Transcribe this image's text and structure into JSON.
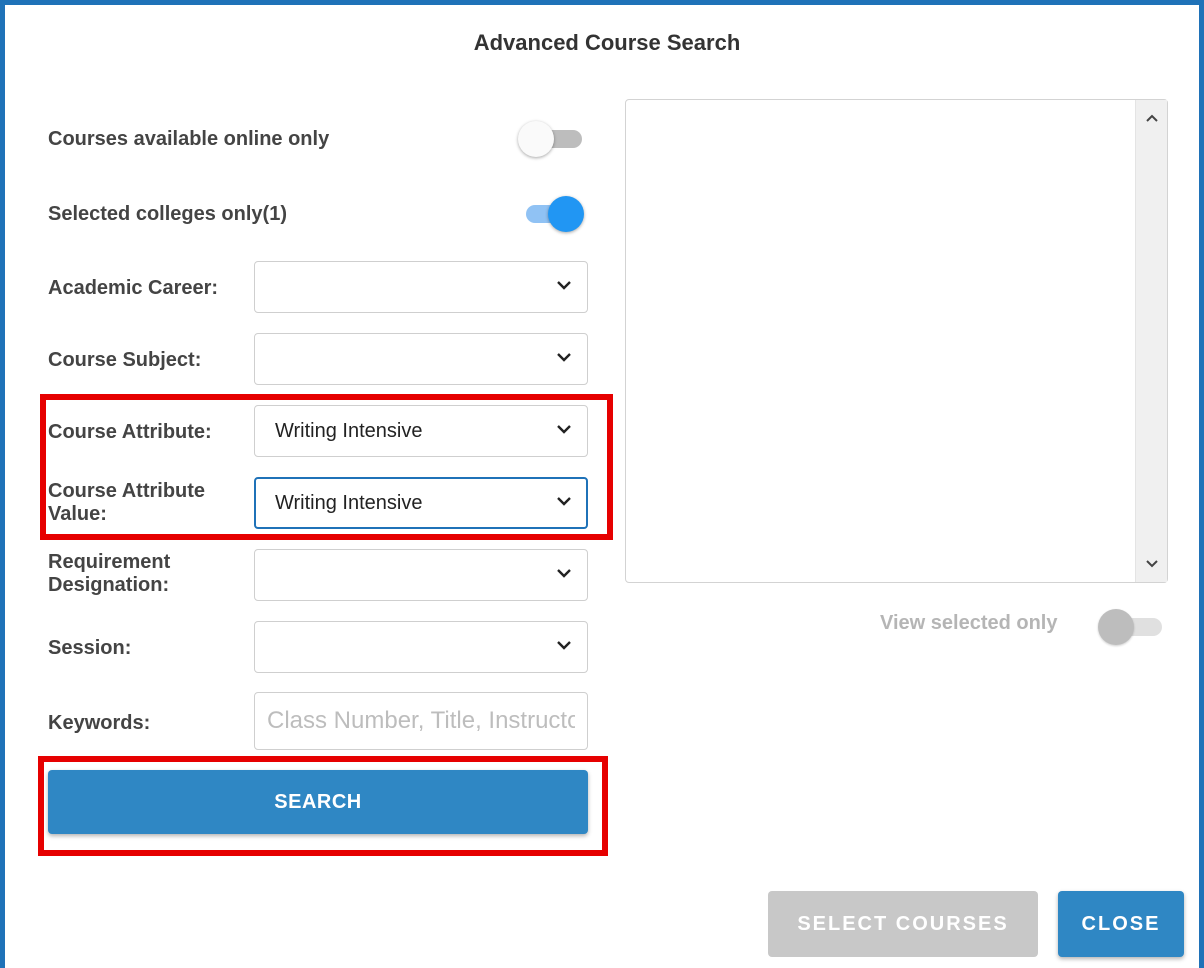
{
  "dialog": {
    "title": "Advanced Course Search"
  },
  "filters": {
    "online_only": {
      "label": "Courses available online only",
      "on": false
    },
    "selected_colleges": {
      "label": "Selected colleges only(1)",
      "on": true
    },
    "academic_career": {
      "label": "Academic Career:",
      "value": ""
    },
    "course_subject": {
      "label": "Course Subject:",
      "value": ""
    },
    "course_attribute": {
      "label": "Course Attribute:",
      "value": "Writing Intensive"
    },
    "course_attribute_value": {
      "label_line1": "Course Attribute",
      "label_line2": "Value:",
      "value": "Writing Intensive"
    },
    "requirement_designation": {
      "label_line1": "Requirement",
      "label_line2": "Designation:",
      "value": ""
    },
    "session": {
      "label": "Session:",
      "value": ""
    },
    "keywords": {
      "label": "Keywords:",
      "placeholder": "Class Number, Title, Instructor",
      "value": ""
    }
  },
  "search_button": {
    "label": "SEARCH"
  },
  "results": {
    "view_selected_label": "View selected only",
    "view_selected_on": false
  },
  "footer": {
    "select_courses_label": "SELECT COURSES",
    "close_label": "CLOSE"
  },
  "colors": {
    "accent": "#2f87c4",
    "toggle_on": "#2196f3",
    "highlight": "#e60000",
    "frame": "#1f72b8",
    "disabled": "#c8c8c8"
  },
  "icons": {
    "select_caret": "chevron-down-icon",
    "scroll_up": "chevron-up-icon",
    "scroll_down": "chevron-down-icon"
  }
}
